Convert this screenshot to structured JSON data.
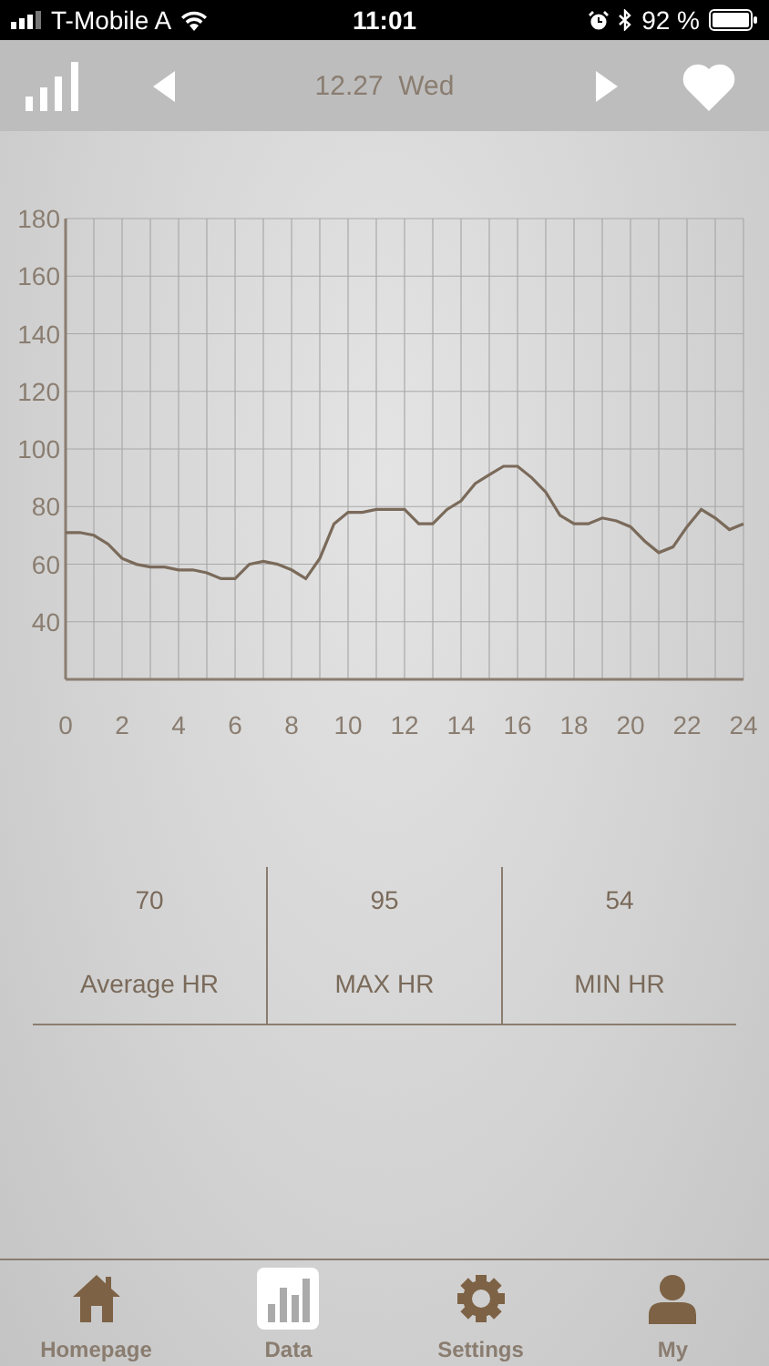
{
  "status_bar": {
    "carrier": "T-Mobile A",
    "time": "11:01",
    "battery": "92 %"
  },
  "header": {
    "date": "12.27  Wed"
  },
  "chart_data": {
    "type": "line",
    "xlim": [
      0,
      24
    ],
    "ylim": [
      20,
      180
    ],
    "xticks": [
      0,
      2,
      4,
      6,
      8,
      10,
      12,
      14,
      16,
      18,
      20,
      22,
      24
    ],
    "yticks": [
      40,
      60,
      80,
      100,
      120,
      140,
      160,
      180
    ],
    "x": [
      0,
      0.5,
      1,
      1.5,
      2,
      2.5,
      3,
      3.5,
      4,
      4.5,
      5,
      5.5,
      6,
      6.5,
      7,
      7.5,
      8,
      8.5,
      9,
      9.5,
      10,
      10.5,
      11,
      11.5,
      12,
      12.5,
      13,
      13.5,
      14,
      14.5,
      15,
      15.5,
      16,
      16.5,
      17,
      17.5,
      18,
      18.5,
      19,
      19.5,
      20,
      20.5,
      21,
      21.5,
      22,
      22.5,
      23,
      23.5,
      24
    ],
    "grid": true,
    "series": [
      {
        "color": "#7a6a5a",
        "values": [
          71,
          71,
          70,
          67,
          62,
          60,
          59,
          59,
          58,
          58,
          57,
          55,
          55,
          60,
          61,
          60,
          58,
          55,
          62,
          74,
          78,
          78,
          79,
          79,
          79,
          74,
          74,
          79,
          82,
          88,
          91,
          94,
          94,
          90,
          85,
          77,
          74,
          74,
          76,
          75,
          73,
          68,
          64,
          66,
          73,
          79,
          76,
          72,
          74
        ]
      }
    ]
  },
  "stats": [
    {
      "value": "70",
      "label": "Average HR"
    },
    {
      "value": "95",
      "label": "MAX HR"
    },
    {
      "value": "54",
      "label": "MIN HR"
    }
  ],
  "tabs": [
    {
      "label": "Homepage",
      "kind": "home",
      "selected": false
    },
    {
      "label": "Data",
      "kind": "data",
      "selected": true
    },
    {
      "label": "Settings",
      "kind": "settings",
      "selected": false
    },
    {
      "label": "My",
      "kind": "user",
      "selected": false
    }
  ]
}
